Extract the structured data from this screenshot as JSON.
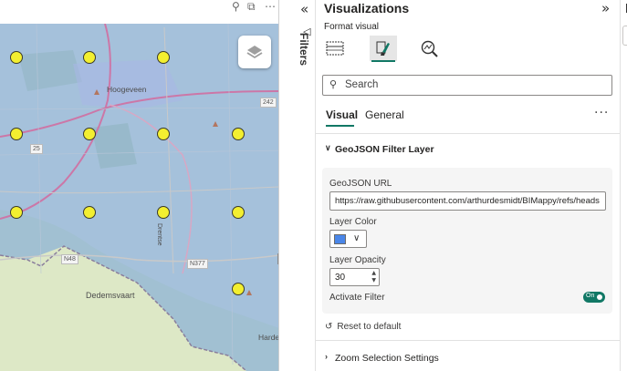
{
  "map": {
    "place_labels": [
      "Hoogeveen",
      "Dedemsvaart",
      "Drentse",
      "Harden"
    ],
    "road_labels": [
      "242",
      "25",
      "N48",
      "N377"
    ],
    "layers_button": "layers-icon"
  },
  "filters": {
    "label": "Filters"
  },
  "visualizations": {
    "title": "Visualizations",
    "format_label": "Format visual",
    "search_placeholder": "Search",
    "tabs": [
      "Visual",
      "General"
    ],
    "more": "···",
    "sections": {
      "geojson": {
        "title": "GeoJSON Filter Layer",
        "url_label": "GeoJSON URL",
        "url_value": "https://raw.githubusercontent.com/arthurdesmidt/BIMappy/refs/heads",
        "color_label": "Layer Color",
        "layer_color": "#4a86e8",
        "opacity_label": "Layer Opacity",
        "opacity_value": "30",
        "activate_label": "Activate Filter",
        "toggle_label": "On"
      },
      "reset_label": "Reset to default",
      "zoom": {
        "title": "Zoom Selection Settings"
      }
    }
  },
  "colors": {
    "accent": "#117865",
    "pin": "#f3ef30",
    "overlay": "#6f9fdc"
  }
}
